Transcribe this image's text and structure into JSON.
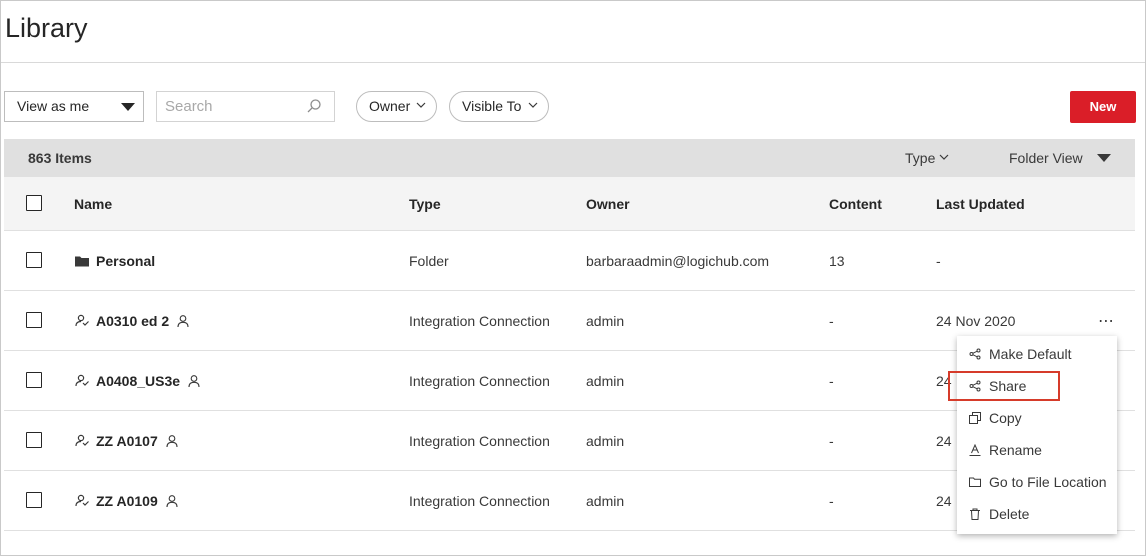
{
  "page": {
    "title": "Library"
  },
  "toolbar": {
    "view_select": "View as me",
    "search_placeholder": "Search",
    "owner_filter": "Owner",
    "visible_to_filter": "Visible To",
    "new_button": "New"
  },
  "info_bar": {
    "item_count": "863 Items",
    "type_filter": "Type",
    "folder_view": "Folder View"
  },
  "table": {
    "headers": {
      "name": "Name",
      "type": "Type",
      "owner": "Owner",
      "content": "Content",
      "last_updated": "Last Updated"
    },
    "rows": [
      {
        "name": "Personal",
        "type": "Folder",
        "owner": "barbaraadmin@logichub.com",
        "content": "13",
        "last_updated": "-",
        "icon": "folder-icon"
      },
      {
        "name": "A0310 ed 2",
        "type": "Integration Connection",
        "owner": "admin",
        "content": "-",
        "last_updated": "24 Nov 2020",
        "icon": "connection-icon"
      },
      {
        "name": "A0408_US3e",
        "type": "Integration Connection",
        "owner": "admin",
        "content": "-",
        "last_updated": "24",
        "icon": "connection-icon"
      },
      {
        "name": "ZZ A0107",
        "type": "Integration Connection",
        "owner": "admin",
        "content": "-",
        "last_updated": "24",
        "icon": "connection-icon"
      },
      {
        "name": "ZZ A0109",
        "type": "Integration Connection",
        "owner": "admin",
        "content": "-",
        "last_updated": "24",
        "icon": "connection-icon"
      }
    ]
  },
  "context_menu": {
    "items": [
      {
        "label": "Make Default",
        "icon": "share-icon"
      },
      {
        "label": "Share",
        "icon": "share-icon"
      },
      {
        "label": "Copy",
        "icon": "copy-icon"
      },
      {
        "label": "Rename",
        "icon": "rename-icon"
      },
      {
        "label": "Go to File Location",
        "icon": "folder-outline-icon"
      },
      {
        "label": "Delete",
        "icon": "trash-icon"
      }
    ]
  },
  "colors": {
    "accent": "#da1e28",
    "highlight_box": "#d63b2a",
    "bar_bg": "#e0e0e0"
  }
}
